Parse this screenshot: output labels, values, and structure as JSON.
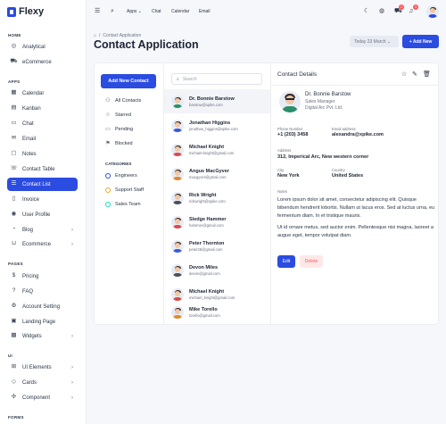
{
  "app": {
    "name": "Flexy",
    "brand_color": "#2b4ce0"
  },
  "sidebar": {
    "sections": {
      "home": "HOME",
      "apps": "APPS",
      "pages": "PAGES",
      "ui": "UI",
      "forms": "FORMS"
    },
    "items": [
      {
        "label": "Analytical",
        "icon": "aperture-icon"
      },
      {
        "label": "eCommerce",
        "icon": "cart-icon"
      },
      {
        "label": "Calendar",
        "icon": "calendar-icon"
      },
      {
        "label": "Kanban",
        "icon": "layout-icon"
      },
      {
        "label": "Chat",
        "icon": "message-icon"
      },
      {
        "label": "Email",
        "icon": "mail-icon"
      },
      {
        "label": "Notes",
        "icon": "notes-icon"
      },
      {
        "label": "Contact Table",
        "icon": "phone-icon"
      },
      {
        "label": "Contact List",
        "icon": "list-icon",
        "active": true
      },
      {
        "label": "Invoice",
        "icon": "file-icon"
      },
      {
        "label": "User Profile",
        "icon": "user-circle-icon"
      },
      {
        "label": "Blog",
        "icon": "chart-donut-icon"
      },
      {
        "label": "Ecommerce",
        "icon": "basket-icon"
      },
      {
        "label": "Pricing",
        "icon": "currency-icon"
      },
      {
        "label": "FAQ",
        "icon": "help-icon"
      },
      {
        "label": "Account Setting",
        "icon": "settings-icon"
      },
      {
        "label": "Landing Page",
        "icon": "app-window-icon"
      },
      {
        "label": "Widgets",
        "icon": "widgets-icon"
      },
      {
        "label": "UI Elements",
        "icon": "layout-grid-icon"
      },
      {
        "label": "Cards",
        "icon": "cards-icon"
      },
      {
        "label": "Component",
        "icon": "components-icon"
      }
    ]
  },
  "topbar": {
    "apps_label": "Apps",
    "links": [
      "Chat",
      "Calendar",
      "Email"
    ],
    "cart_count": "2",
    "notif_count": "3"
  },
  "page": {
    "breadcrumb": "Contact Application",
    "title": "Contact Application",
    "date_button": "Today 23 March",
    "add_button": "+ Add New"
  },
  "filters": {
    "add_contact": "Add New Contact",
    "items": [
      {
        "label": "All Contacts",
        "icon": "users-icon"
      },
      {
        "label": "Starred",
        "icon": "star-icon"
      },
      {
        "label": "Pending",
        "icon": "clipboard-icon"
      },
      {
        "label": "Blocked",
        "icon": "flag-icon"
      }
    ],
    "categories_title": "CATEGORIES",
    "categories": [
      {
        "label": "Engineers",
        "color": "#2b4ce0"
      },
      {
        "label": "Support Staff",
        "color": "#f5a623"
      },
      {
        "label": "Sales Team",
        "color": "#13deb9"
      }
    ]
  },
  "search": {
    "placeholder": "Search"
  },
  "contacts": [
    {
      "name": "Dr. Bonnie Barstow",
      "email": "barstow@xpike.com",
      "selected": true
    },
    {
      "name": "Jonathan Higgins",
      "email": "jonathan_higgins@xpike.com"
    },
    {
      "name": "Michael Knight",
      "email": "michael-knight@gmail.com"
    },
    {
      "name": "Angus MacGyver",
      "email": "macgyver@gmail.com"
    },
    {
      "name": "Rick Wright",
      "email": "rickwright@xpike.com"
    },
    {
      "name": "Sledge Hammer",
      "email": "hammer@gmail.com"
    },
    {
      "name": "Peter Thornton",
      "email": "peter28@gmail.com"
    },
    {
      "name": "Devon Miles",
      "email": "devon@gmail.com"
    },
    {
      "name": "Michael Knight",
      "email": "michael_knight@gmail.com"
    },
    {
      "name": "Mike Torello",
      "email": "torello@gmail.com"
    }
  ],
  "details": {
    "heading": "Contact Details",
    "name": "Dr. Bonnie Barstow",
    "role": "Sales Manager",
    "company": "Digital Arc Pvt. Ltd.",
    "phone_label": "Phone Number",
    "phone": "+1 (203) 3458",
    "email_label": "Email address",
    "email": "alexandra@xpike.com",
    "address_label": "Address",
    "address": "312, Imperical Arc, New western corner",
    "city_label": "City",
    "city": "New York",
    "country_label": "Country",
    "country": "United States",
    "notes_label": "Notes",
    "notes_1": "Lorem ipsum dolor sit amet, consectetur adipiscing elit. Quisque bibendum hendrerit lobortis. Nullam ut lacus eros. Sed at luctus urna, eu fermentum diam. In et tristique mauris.",
    "notes_2": "Ut id ornare metus, sed auctor enim. Pellentesque nisi magna, laoreet a augue eget, tempor volutpat diam.",
    "edit": "Edit",
    "delete": "Delete"
  }
}
